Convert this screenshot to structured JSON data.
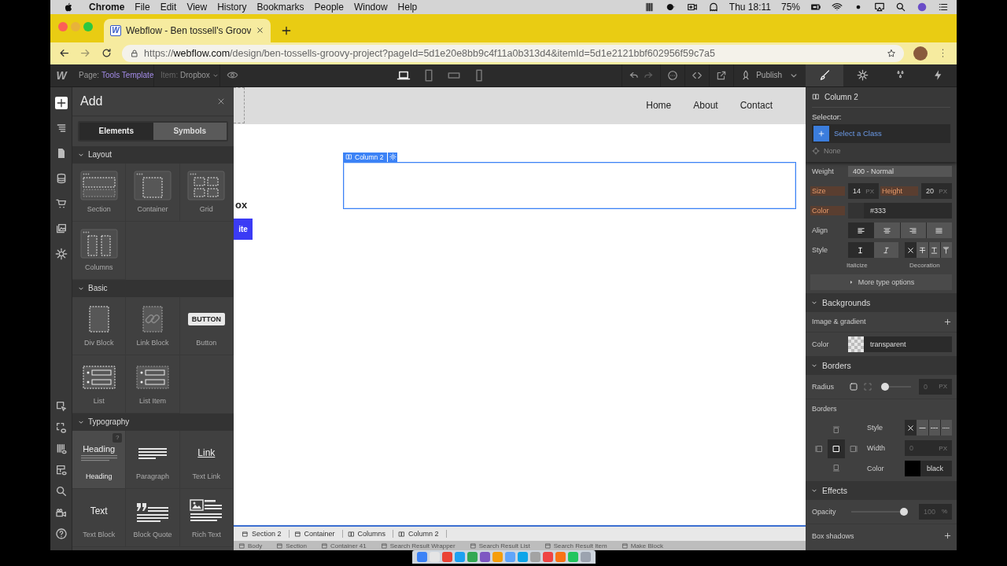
{
  "menubar": {
    "app": "Chrome",
    "menus": [
      "File",
      "Edit",
      "View",
      "History",
      "Bookmarks",
      "People",
      "Window",
      "Help"
    ],
    "clock": "Thu 18:11",
    "battery": "75%"
  },
  "browser": {
    "tab": {
      "favicon": "W",
      "title": "Webflow - Ben tossell's Groov"
    },
    "url": {
      "scheme": "https://",
      "host": "webflow.com",
      "path": "/design/ben-tossells-groovy-project?pageId=5d1e20e8bb9c4f11a0b313d4&itemId=5d1e2121bbf602956f59c7a5"
    }
  },
  "designer": {
    "logo": "W",
    "page_label": "Page:",
    "page": "Tools Template",
    "item_label": "Item:",
    "item": "Dropbox",
    "devices": [
      {
        "kind": "laptop",
        "selected": true
      },
      {
        "kind": "tablet",
        "selected": false
      },
      {
        "kind": "landscape",
        "selected": false
      },
      {
        "kind": "phone",
        "selected": false
      }
    ],
    "publish": "Publish",
    "panels": [
      {
        "kind": "brush",
        "selected": true
      },
      {
        "kind": "gear",
        "selected": false
      },
      {
        "kind": "drops",
        "selected": false
      },
      {
        "kind": "bolt",
        "selected": false
      }
    ]
  },
  "rail": {
    "top": [
      {
        "kind": "plus",
        "selected": true
      },
      {
        "kind": "navigator",
        "selected": false
      },
      {
        "kind": "pages",
        "selected": false
      },
      {
        "kind": "cms",
        "selected": false
      },
      {
        "kind": "ecommerce",
        "selected": false
      },
      {
        "kind": "assets",
        "selected": false
      },
      {
        "kind": "gear",
        "selected": false
      }
    ],
    "bottom": [
      {
        "kind": "select",
        "selected": false
      },
      {
        "kind": "xray",
        "selected": false
      },
      {
        "kind": "gridpreview",
        "selected": false
      },
      {
        "kind": "layoutpreview",
        "selected": false
      },
      {
        "kind": "search",
        "selected": false
      },
      {
        "kind": "video",
        "selected": false
      },
      {
        "kind": "help",
        "selected": false
      }
    ]
  },
  "add_panel": {
    "title": "Add",
    "tabs": [
      {
        "label": "Elements",
        "selected": true
      },
      {
        "label": "Symbols",
        "selected": false
      }
    ],
    "sections": [
      {
        "title": "Layout",
        "expanded": true,
        "items": [
          {
            "kind": "section",
            "label": "Section",
            "hovered": false
          },
          {
            "kind": "container",
            "label": "Container",
            "hovered": false
          },
          {
            "kind": "grid",
            "label": "Grid",
            "hovered": false
          },
          {
            "kind": "columns",
            "label": "Columns",
            "hovered": false
          }
        ]
      },
      {
        "title": "Basic",
        "expanded": true,
        "items": [
          {
            "kind": "div",
            "label": "Div Block",
            "hovered": false
          },
          {
            "kind": "linkblock",
            "label": "Link Block",
            "hovered": false
          },
          {
            "kind": "button",
            "label": "Button",
            "preview": "BUTTON",
            "hovered": false
          },
          {
            "kind": "list",
            "label": "List",
            "hovered": false
          },
          {
            "kind": "listitem",
            "label": "List Item",
            "hovered": false
          }
        ]
      },
      {
        "title": "Typography",
        "expanded": true,
        "items": [
          {
            "kind": "heading",
            "label": "Heading",
            "preview": "Heading",
            "help": "?",
            "hovered": true
          },
          {
            "kind": "paragraph",
            "label": "Paragraph",
            "hovered": false
          },
          {
            "kind": "link",
            "label": "Text Link",
            "preview": "Link",
            "hovered": false
          },
          {
            "kind": "text",
            "label": "Text Block",
            "preview": "Text",
            "hovered": false
          },
          {
            "kind": "quote",
            "label": "Block Quote",
            "hovered": false
          },
          {
            "kind": "richtext",
            "label": "Rich Text",
            "hovered": false
          }
        ]
      }
    ]
  },
  "canvas": {
    "nav_links": [
      "Home",
      "About",
      "Contact"
    ],
    "heading_fragment": "ox",
    "button_fragment": "ite",
    "selected_element": {
      "label": "Column 2"
    },
    "breadcrumbs": [
      {
        "kind": "box",
        "label": "Section 2"
      },
      {
        "kind": "box",
        "label": "Container"
      },
      {
        "kind": "columns",
        "label": "Columns"
      },
      {
        "kind": "columns",
        "label": "Column 2"
      }
    ],
    "path": [
      {
        "kind": "box",
        "label": "Body"
      },
      {
        "kind": "box",
        "label": "Section"
      },
      {
        "kind": "box",
        "label": "Container 41"
      },
      {
        "kind": "box",
        "label": "Search Result Wrapper"
      },
      {
        "kind": "box",
        "label": "Search Result List"
      },
      {
        "kind": "box",
        "label": "Search Result Item"
      },
      {
        "kind": "box",
        "label": "Make Block"
      }
    ]
  },
  "style_panel": {
    "element": "Column 2",
    "selector": {
      "label": "Selector:",
      "placeholder": "Select a Class",
      "state": "None"
    },
    "typography": {
      "weight": {
        "label": "Weight",
        "value": "400 - Normal",
        "set": false
      },
      "size": {
        "label": "Size",
        "value": "14",
        "unit": "PX",
        "set": true
      },
      "height": {
        "label": "Height",
        "value": "20",
        "unit": "PX",
        "set": true
      },
      "color": {
        "label": "Color",
        "value": "#333",
        "set": true
      },
      "align": {
        "label": "Align",
        "options": [
          {
            "kind": "align-left",
            "selected": true
          },
          {
            "kind": "align-center",
            "selected": false
          },
          {
            "kind": "align-right",
            "selected": false
          },
          {
            "kind": "align-justify",
            "selected": false
          }
        ]
      },
      "style": {
        "label": "Style",
        "italic": [
          {
            "kind": "upright",
            "selected": true
          },
          {
            "kind": "italic",
            "selected": false
          }
        ],
        "italic_caption": "Italicize",
        "decoration": [
          {
            "kind": "close",
            "selected": true
          },
          {
            "kind": "strike",
            "selected": false
          },
          {
            "kind": "underline",
            "selected": false
          },
          {
            "kind": "overline",
            "selected": false
          }
        ],
        "decoration_caption": "Decoration"
      },
      "more": {
        "label": "More type options",
        "expanded": false
      }
    },
    "backgrounds": {
      "title": "Backgrounds",
      "expanded": true,
      "image_label": "Image & gradient",
      "color_label": "Color",
      "color_value": "transparent"
    },
    "borders": {
      "title": "Borders",
      "expanded": true,
      "radius_label": "Radius",
      "radius_modes": [
        {
          "kind": "radius-all",
          "selected": true
        },
        {
          "kind": "radius-each",
          "selected": false
        }
      ],
      "radius_slider": {
        "level": 0
      },
      "radius_value": "0",
      "radius_unit": "PX",
      "sides_label": "Borders",
      "sides": [
        {
          "kind": "side-top",
          "selected": false
        },
        {
          "kind": "side-left",
          "selected": false
        },
        {
          "kind": "side-all",
          "selected": true
        },
        {
          "kind": "side-right",
          "selected": false
        },
        {
          "kind": "side-bottom",
          "selected": false
        }
      ],
      "style_label": "Style",
      "styles": [
        {
          "kind": "close",
          "selected": true
        },
        {
          "kind": "line-solid",
          "selected": false
        },
        {
          "kind": "line-dashed",
          "selected": false
        },
        {
          "kind": "line-dotted",
          "selected": false
        }
      ],
      "width_label": "Width",
      "width_placeholder": "0",
      "width_unit": "PX",
      "color_label": "Color",
      "color_value": "black"
    },
    "effects": {
      "title": "Effects",
      "expanded": true,
      "opacity_label": "Opacity",
      "opacity_slider": {
        "level": 1
      },
      "opacity_value": "100",
      "opacity_unit": "%",
      "shadows_label": "Box shadows"
    }
  }
}
